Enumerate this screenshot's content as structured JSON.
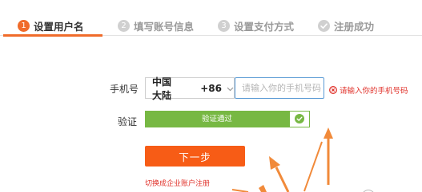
{
  "steps": [
    {
      "number": "1",
      "label": "设置用户名",
      "state": "active"
    },
    {
      "number": "2",
      "label": "填写账号信息",
      "state": "pending"
    },
    {
      "number": "3",
      "label": "设置支付方式",
      "state": "pending"
    },
    {
      "number": "",
      "label": "注册成功",
      "state": "pending"
    }
  ],
  "form": {
    "phone_label": "手机号",
    "region": "中国大陆",
    "country_code": "+86",
    "phone_placeholder": "请输入你的手机号码",
    "phone_value": "",
    "error_message": "请输入你的手机号码",
    "verify_label": "验证",
    "verify_status": "验证通过",
    "next_button": "下一步",
    "enterprise_link": "切换成企业账户注册"
  },
  "colors": {
    "accent": "#f06b2a",
    "button": "#f75c16",
    "error": "#e0312a",
    "success": "#77b843",
    "input_focus_border": "#5b9bd5"
  },
  "icons": {
    "step_done": "check-circle-icon",
    "region_dropdown": "chevron-down-icon",
    "error": "error-circle-icon",
    "verify_ok": "check-icon",
    "annotation": "arrow-icon"
  }
}
